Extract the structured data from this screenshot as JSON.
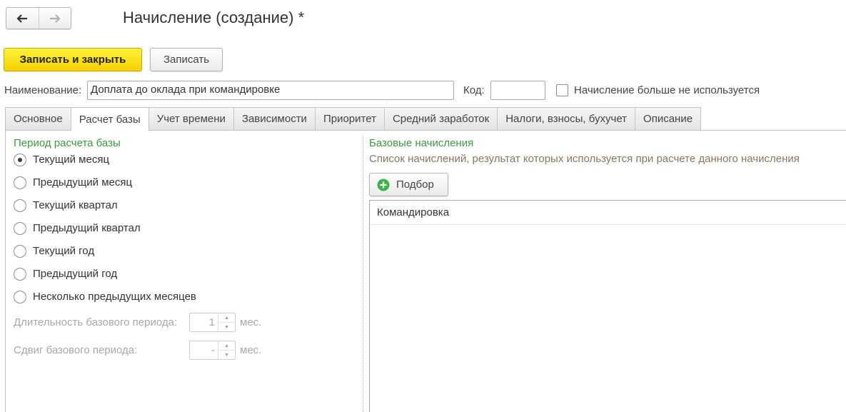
{
  "header": {
    "title": "Начисление (создание) *"
  },
  "nav": {
    "back_icon": "arrow-left-icon",
    "forward_icon": "arrow-right-icon"
  },
  "toolbar": {
    "save_close_label": "Записать и закрыть",
    "save_label": "Записать"
  },
  "form": {
    "name_label": "Наименование:",
    "name_value": "Доплата до оклада при командировке",
    "code_label": "Код:",
    "code_value": "",
    "unused_label": "Начисление больше не используется",
    "unused_checked": false
  },
  "tabs": [
    {
      "label": "Основное"
    },
    {
      "label": "Расчет базы",
      "active": true
    },
    {
      "label": "Учет времени"
    },
    {
      "label": "Зависимости"
    },
    {
      "label": "Приоритет"
    },
    {
      "label": "Средний заработок"
    },
    {
      "label": "Налоги, взносы, бухучет"
    },
    {
      "label": "Описание"
    }
  ],
  "period": {
    "title": "Период расчета базы",
    "options": [
      {
        "label": "Текущий месяц",
        "selected": true
      },
      {
        "label": "Предыдущий месяц"
      },
      {
        "label": "Текущий квартал"
      },
      {
        "label": "Предыдущий квартал"
      },
      {
        "label": "Текущий год"
      },
      {
        "label": "Предыдущий год"
      },
      {
        "label": "Несколько предыдущих месяцев"
      }
    ],
    "duration_label": "Длительность базового периода:",
    "duration_value": "1",
    "duration_unit": "мес.",
    "shift_label": "Сдвиг базового периода:",
    "shift_value": "-",
    "shift_unit": "мес."
  },
  "base": {
    "title": "Базовые начисления",
    "hint": "Список начислений, результат которых используется при расчете данного начисления",
    "pick_label": "Подбор",
    "rows": [
      {
        "name": "Командировка"
      }
    ]
  },
  "colors": {
    "accent_yellow": "#f7e11a",
    "group_green": "#3f9a3f",
    "hint_brown": "#8a7560"
  }
}
